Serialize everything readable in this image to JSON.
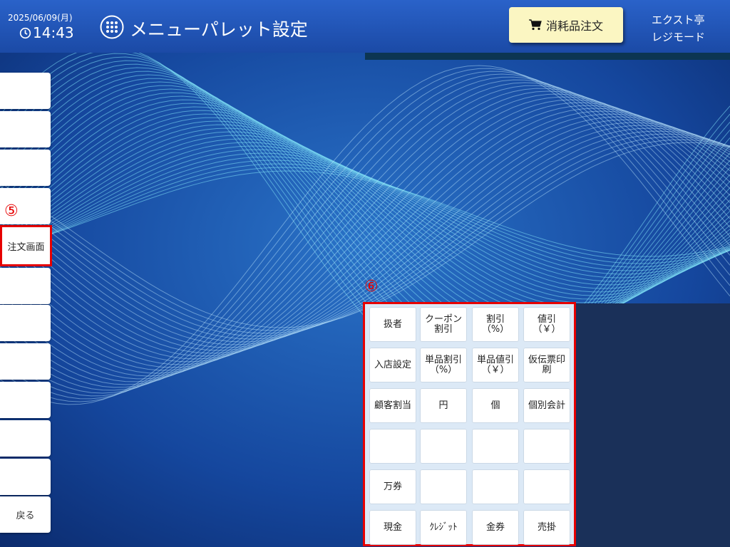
{
  "header": {
    "date": "2025/06/09(月)",
    "time": "14:43",
    "title": "メニューパレット設定",
    "order_button_label": "消耗品注文",
    "shop_name": "エクスト亭",
    "mode": "レジモード"
  },
  "annotations": {
    "marker_5": "⑤",
    "marker_6": "⑥"
  },
  "sidebar": {
    "highlighted_label": "注文画面",
    "back_label": "戻る"
  },
  "palette": {
    "rows": [
      [
        "扱者",
        "クーポン\n割引",
        "割引\n（%）",
        "値引\n（￥）"
      ],
      [
        "入店設定",
        "単品割引\n（%）",
        "単品値引\n（￥）",
        "仮伝票印\n刷"
      ],
      [
        "顧客割当",
        "円",
        "個",
        "個別会計"
      ],
      [
        "",
        "",
        "",
        ""
      ],
      [
        "万券",
        "",
        "",
        ""
      ],
      [
        "現金",
        "ｸﾚｼﾞｯﾄ",
        "金券",
        "売掛"
      ]
    ]
  },
  "colors": {
    "header": "#1f52b3",
    "highlight": "#e60000",
    "order_button": "#fbf6c2"
  },
  "icons": {
    "clock": "clock-icon",
    "menu_grid": "grid-icon",
    "cart": "cart-icon"
  }
}
